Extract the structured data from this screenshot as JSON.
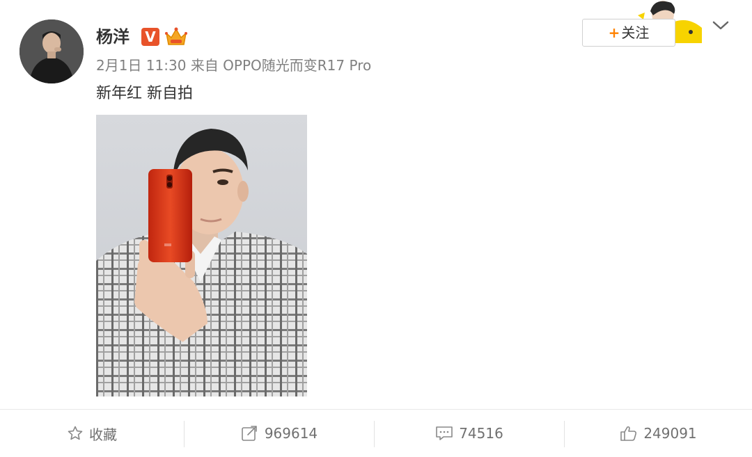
{
  "post": {
    "username": "杨洋",
    "verified_badge": "V",
    "date": "2月1日 11:30",
    "source_prefix": "来自",
    "source": "OPPO随光而变R17 Pro",
    "text": "新年红 新自拍"
  },
  "follow": {
    "plus": "+",
    "label": "关注"
  },
  "footer": {
    "favorite_label": "收藏",
    "repost_count": "969614",
    "comment_count": "74516",
    "like_count": "249091"
  },
  "colors": {
    "accent": "#ff8200",
    "verified": "#e8532a",
    "phone": "#e03a1e"
  },
  "icons": [
    "chevron-down-icon",
    "star-icon",
    "share-icon",
    "comment-icon",
    "thumbs-up-icon",
    "crown-icon"
  ]
}
